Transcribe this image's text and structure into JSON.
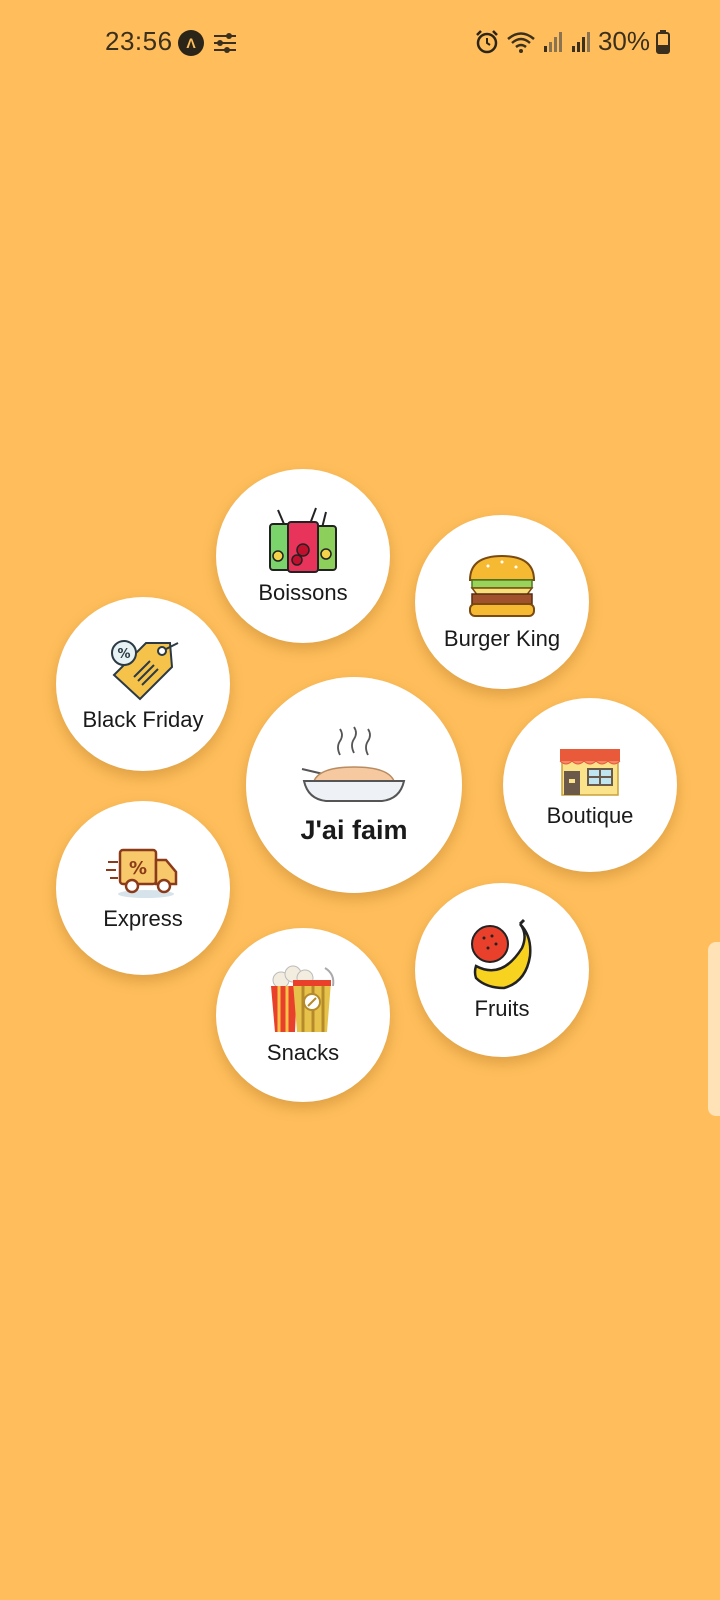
{
  "status_bar": {
    "time": "23:56",
    "battery_percent": "30%",
    "icons": [
      "app-a-icon",
      "sliders-icon",
      "alarm-icon",
      "wifi-icon",
      "signal-icon",
      "signal-icon",
      "battery-icon"
    ]
  },
  "menu": {
    "center": {
      "label": "J'ai faim",
      "icon": "hot-dish-icon"
    },
    "items": [
      {
        "label": "Boissons",
        "icon": "drinks-icon"
      },
      {
        "label": "Burger King",
        "icon": "burger-icon"
      },
      {
        "label": "Black Friday",
        "icon": "price-tag-icon"
      },
      {
        "label": "Boutique",
        "icon": "shop-icon"
      },
      {
        "label": "Express",
        "icon": "delivery-truck-icon"
      },
      {
        "label": "Fruits",
        "icon": "fruits-icon"
      },
      {
        "label": "Snacks",
        "icon": "popcorn-icon"
      }
    ]
  },
  "colors": {
    "background": "#FFBE5B",
    "bubble": "#FFFFFF",
    "text": "#1A1A1A"
  }
}
